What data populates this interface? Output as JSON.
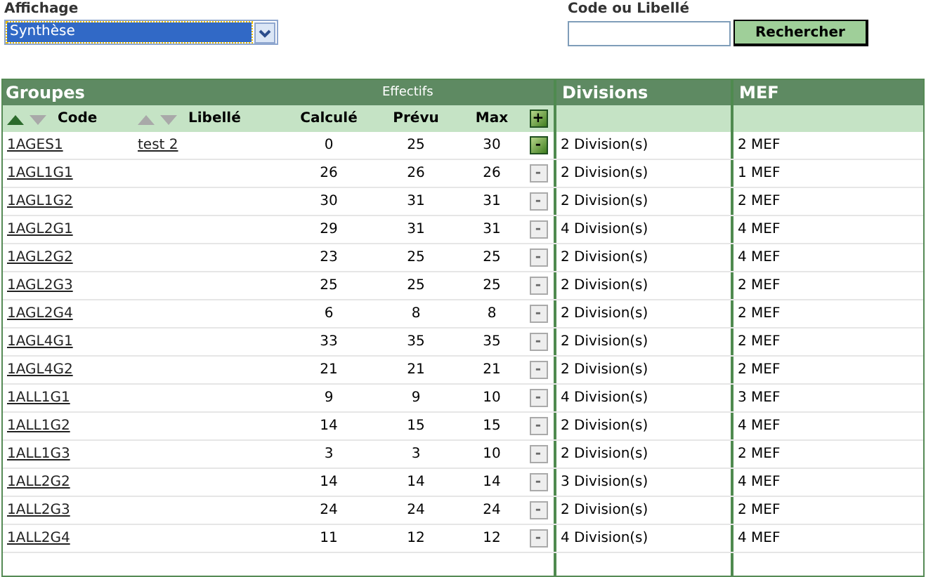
{
  "filters": {
    "display_label": "Affichage",
    "display_value": "Synthèse",
    "search_label": "Code ou Libellé",
    "search_button": "Rechercher"
  },
  "table": {
    "title": "Groupes",
    "group_header": "Effectifs",
    "divisions_header": "Divisions",
    "mef_header": "MEF",
    "add_button": "+",
    "columns": [
      {
        "label": "Code",
        "sort_asc": true
      },
      {
        "label": "Libellé",
        "sort_asc": false
      },
      {
        "label": "Calculé"
      },
      {
        "label": "Prévu"
      },
      {
        "label": "Max"
      }
    ],
    "rows": [
      {
        "code": "1AGES1",
        "libelle": "test 2",
        "calcule": "0",
        "prevu": "25",
        "max": "30",
        "remove": "-",
        "disabled": false,
        "divisions": "2 Division(s)",
        "mef": "2 MEF"
      },
      {
        "code": "1AGL1G1",
        "calcule": "26",
        "prevu": "26",
        "max": "26",
        "remove": "-",
        "disabled": true,
        "divisions": "2 Division(s)",
        "mef": "1 MEF"
      },
      {
        "code": "1AGL1G2",
        "calcule": "30",
        "prevu": "31",
        "max": "31",
        "remove": "-",
        "disabled": true,
        "divisions": "2 Division(s)",
        "mef": "2 MEF"
      },
      {
        "code": "1AGL2G1",
        "calcule": "29",
        "prevu": "31",
        "max": "31",
        "remove": "-",
        "disabled": true,
        "divisions": "4 Division(s)",
        "mef": "4 MEF"
      },
      {
        "code": "1AGL2G2",
        "calcule": "23",
        "prevu": "25",
        "max": "25",
        "remove": "-",
        "disabled": true,
        "divisions": "2 Division(s)",
        "mef": "4 MEF"
      },
      {
        "code": "1AGL2G3",
        "calcule": "25",
        "prevu": "25",
        "max": "25",
        "remove": "-",
        "disabled": true,
        "divisions": "2 Division(s)",
        "mef": "2 MEF"
      },
      {
        "code": "1AGL2G4",
        "calcule": "6",
        "prevu": "8",
        "max": "8",
        "remove": "-",
        "disabled": true,
        "divisions": "2 Division(s)",
        "mef": "2 MEF"
      },
      {
        "code": "1AGL4G1",
        "calcule": "33",
        "prevu": "35",
        "max": "35",
        "remove": "-",
        "disabled": true,
        "divisions": "2 Division(s)",
        "mef": "2 MEF"
      },
      {
        "code": "1AGL4G2",
        "calcule": "21",
        "prevu": "21",
        "max": "21",
        "remove": "-",
        "disabled": true,
        "divisions": "2 Division(s)",
        "mef": "2 MEF"
      },
      {
        "code": "1ALL1G1",
        "calcule": "9",
        "prevu": "9",
        "max": "10",
        "remove": "-",
        "disabled": true,
        "divisions": "4 Division(s)",
        "mef": "3 MEF"
      },
      {
        "code": "1ALL1G2",
        "calcule": "14",
        "prevu": "15",
        "max": "15",
        "remove": "-",
        "disabled": true,
        "divisions": "2 Division(s)",
        "mef": "4 MEF"
      },
      {
        "code": "1ALL1G3",
        "calcule": "3",
        "prevu": "3",
        "max": "10",
        "remove": "-",
        "disabled": true,
        "divisions": "2 Division(s)",
        "mef": "2 MEF"
      },
      {
        "code": "1ALL2G2",
        "calcule": "14",
        "prevu": "14",
        "max": "14",
        "remove": "-",
        "disabled": true,
        "divisions": "3 Division(s)",
        "mef": "4 MEF"
      },
      {
        "code": "1ALL2G3",
        "calcule": "24",
        "prevu": "24",
        "max": "24",
        "remove": "-",
        "disabled": true,
        "divisions": "2 Division(s)",
        "mef": "2 MEF"
      },
      {
        "code": "1ALL2G4",
        "calcule": "11",
        "prevu": "12",
        "max": "12",
        "remove": "-",
        "disabled": true,
        "divisions": "4 Division(s)",
        "mef": "4 MEF"
      }
    ]
  }
}
